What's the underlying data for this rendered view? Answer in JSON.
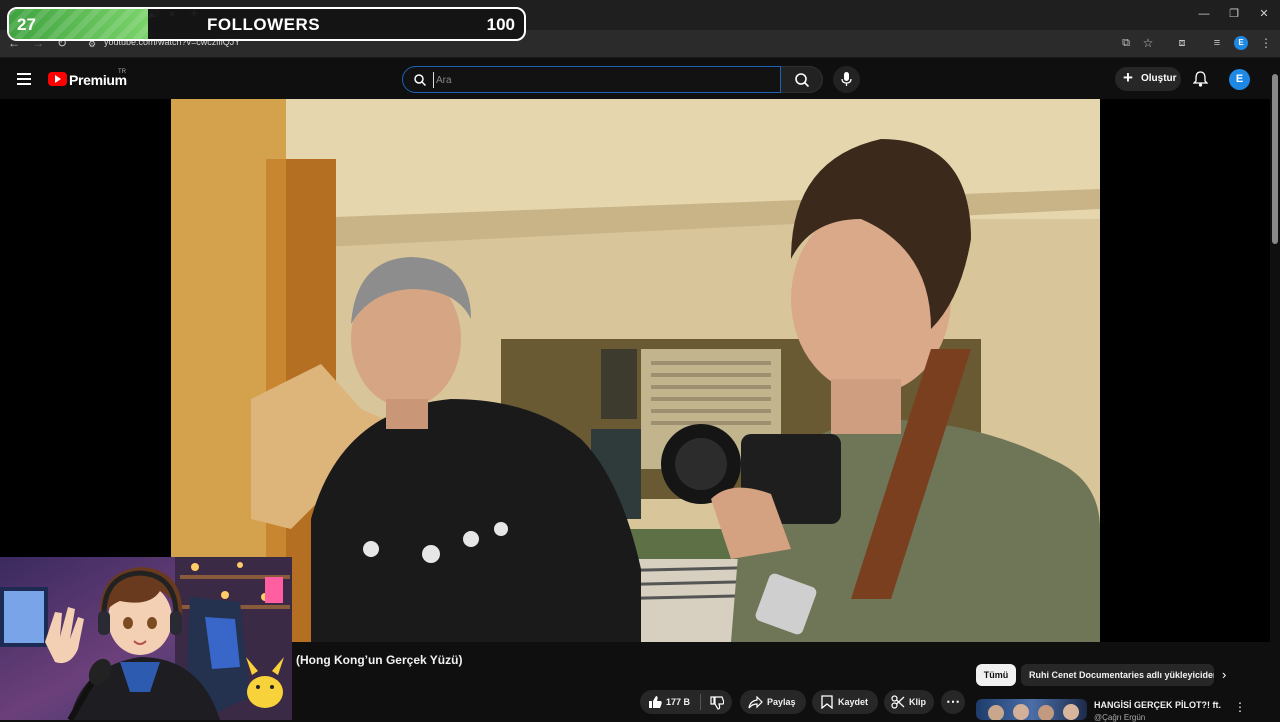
{
  "stream_overlay": {
    "followers_current": "27",
    "followers_label": "FOLLOWERS",
    "followers_goal": "100",
    "progress_fraction": 0.27,
    "fill_color": "#5bbf4e"
  },
  "browser": {
    "url": "youtube.com/watch?v=cwcziflQJY",
    "profile_initial": "E"
  },
  "masthead": {
    "logo_text": "Premium",
    "logo_region": "TR",
    "search_placeholder": "Ara",
    "create_label": "Oluştur",
    "avatar_initial": "E"
  },
  "video": {
    "title": "(Hong Kong’un Gerçek Yüzü)"
  },
  "actions": {
    "like_count": "177 B",
    "share_label": "Paylaş",
    "save_label": "Kaydet",
    "clip_label": "Klip"
  },
  "recommendations": {
    "chips": [
      "Tümü",
      "Ruhi Cenet Documentaries adlı yükleyiciden"
    ],
    "next_title": "HANGİSİ GERÇEK PİLOT?! ft.",
    "next_channel": "@Çağrı Ergün"
  },
  "colors": {
    "accent_red": "#ff0000",
    "accent_blue": "#1e88e5",
    "search_focus": "#1c62b9"
  }
}
